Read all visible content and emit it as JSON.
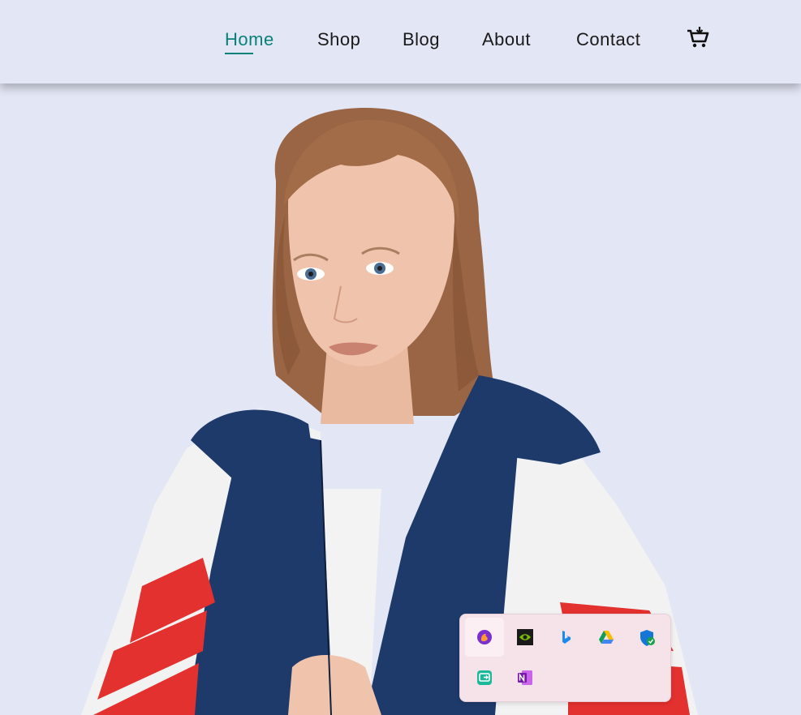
{
  "nav": {
    "items": [
      {
        "label": "Home",
        "active": true
      },
      {
        "label": "Shop",
        "active": false
      },
      {
        "label": "Blog",
        "active": false
      },
      {
        "label": "About",
        "active": false
      },
      {
        "label": "Contact",
        "active": false
      }
    ],
    "cart_icon": "cart-icon"
  },
  "hero": {
    "image": "model-in-windbreaker-jacket",
    "background_color": "#e3e6f5"
  },
  "tray": {
    "icons": [
      "firefox-dev-icon",
      "nvidia-icon",
      "bing-icon",
      "google-drive-icon",
      "windows-security-icon",
      "remote-desktop-icon",
      "onenote-icon"
    ]
  },
  "colors": {
    "accent": "#088178",
    "text": "#1a1a1a",
    "background": "#e3e6f5"
  }
}
